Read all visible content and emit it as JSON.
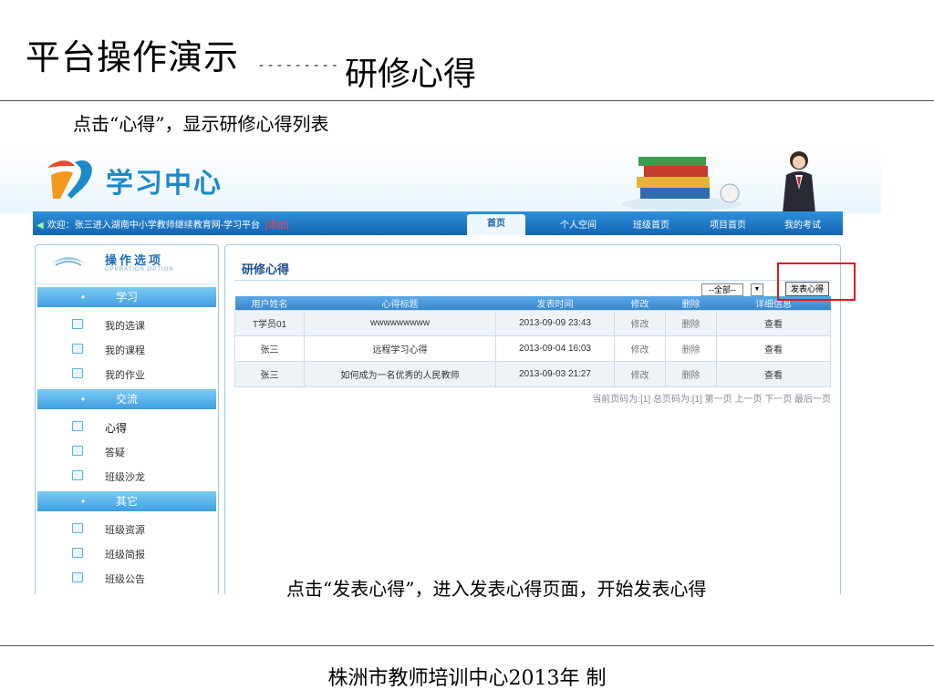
{
  "slide": {
    "title": "平台操作演示",
    "dashes": "---------",
    "subtitle": "研修心得",
    "caption_top": "点击“心得”，显示研修心得列表",
    "caption_bottom": "点击“发表心得”，进入发表心得页面，开始发表心得",
    "footer": "株洲市教师培训中心2013年 制"
  },
  "screenshot": {
    "logo_text": "学习中心",
    "welcome": "欢迎：张三进入湖南中小学教师继续教育网-学习平台",
    "exit_label": "[退出]",
    "nav_tabs": [
      "首页",
      "个人空间",
      "班级首页",
      "项目首页",
      "我的考试"
    ],
    "sidebar": {
      "header_title": "操作选项",
      "header_sub": "OPERATION OPTION",
      "sections": [
        {
          "title": "学习",
          "items": [
            "我的选课",
            "我的课程",
            "我的作业"
          ]
        },
        {
          "title": "交流",
          "items": [
            "心得",
            "答疑",
            "班级沙龙"
          ]
        },
        {
          "title": "其它",
          "items": [
            "班级资源",
            "班级简报",
            "班级公告"
          ]
        }
      ]
    },
    "content": {
      "title": "研修心得",
      "filter_value": "--全部--",
      "filter_arrow": "▼",
      "post_button": "发表心得",
      "columns": [
        "用户姓名",
        "心得标题",
        "发表时间",
        "修改",
        "删除",
        "详细信息"
      ],
      "rows": [
        [
          "T学员01",
          "wwwwwwwww",
          "2013-09-09 23:43",
          "修改",
          "删除",
          "查看"
        ],
        [
          "张三",
          "远程学习心得",
          "2013-09-04 16:03",
          "修改",
          "删除",
          "查看"
        ],
        [
          "张三",
          "如何成为一名优秀的人民教师",
          "2013-09-03 21:27",
          "修改",
          "删除",
          "查看"
        ]
      ],
      "pager": "当前页码为:[1] 总页码为:[1] 第一页 上一页 下一页 最后一页"
    }
  },
  "colors": {
    "highlight": "#e0191c",
    "nav_blue": "#1364b4",
    "brand_blue": "#1c8ac9"
  }
}
